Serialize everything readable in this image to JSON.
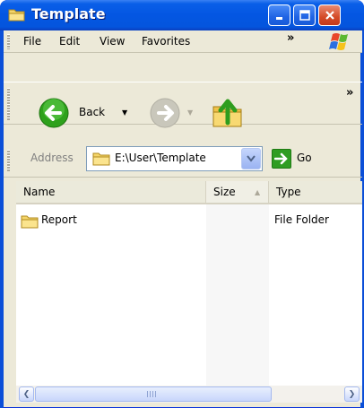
{
  "window": {
    "title": "Template",
    "title_icon": "folder-icon"
  },
  "titlebar_buttons": {
    "minimize": "minimize-icon",
    "maximize": "maximize-icon",
    "close": "close-icon"
  },
  "menu": {
    "items": [
      "File",
      "Edit",
      "View",
      "Favorites"
    ],
    "overflow": "»",
    "logo": "windows-logo-icon"
  },
  "toolbar": {
    "back_label": "Back",
    "overflow": "»",
    "dropdown_glyph": "▼"
  },
  "address": {
    "label": "Address",
    "value": "E:\\User\\Template",
    "go_label": "Go"
  },
  "list": {
    "columns": [
      "Name",
      "Size",
      "Type"
    ],
    "sort_glyph": "▲",
    "rows": [
      {
        "name": "Report",
        "size": "",
        "type": "File Folder",
        "icon": "folder-icon"
      }
    ]
  },
  "scrollbar": {
    "left_glyph": "❮",
    "right_glyph": "❯"
  },
  "colors": {
    "titlebar": "#0456e2",
    "frame": "#ece9d8",
    "go_green": "#2f9d22"
  }
}
